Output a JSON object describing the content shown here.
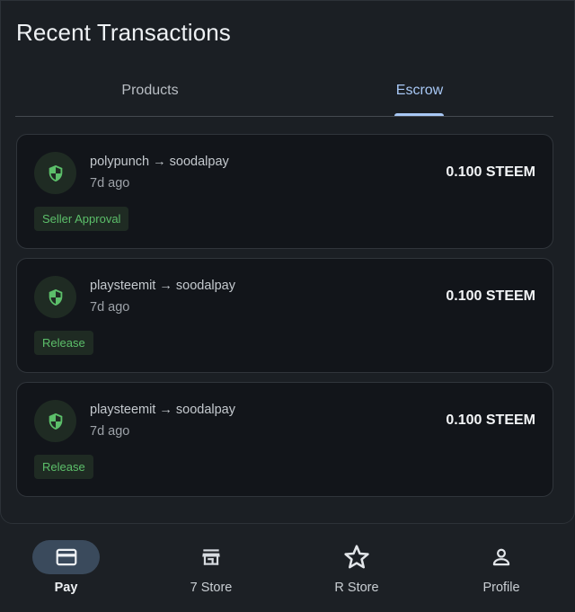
{
  "header": {
    "title": "Recent Transactions"
  },
  "tabs": [
    {
      "label": "Products",
      "active": false
    },
    {
      "label": "Escrow",
      "active": true
    }
  ],
  "transactions": [
    {
      "from": "polypunch",
      "to": "soodalpay",
      "parties": "polypunch → soodalpay",
      "time": "7d ago",
      "amount": "0.100 STEEM",
      "status": "Seller Approval"
    },
    {
      "from": "playsteemit",
      "to": "soodalpay",
      "parties": "playsteemit → soodalpay",
      "time": "7d ago",
      "amount": "0.100 STEEM",
      "status": "Release"
    },
    {
      "from": "playsteemit",
      "to": "soodalpay",
      "parties": "playsteemit → soodalpay",
      "time": "7d ago",
      "amount": "0.100 STEEM",
      "status": "Release"
    }
  ],
  "bottom_nav": [
    {
      "label": "Pay",
      "icon": "credit-card-icon",
      "active": true
    },
    {
      "label": "7 Store",
      "icon": "storefront-icon",
      "active": false
    },
    {
      "label": "R Store",
      "icon": "star-icon",
      "active": false
    },
    {
      "label": "Profile",
      "icon": "person-icon",
      "active": false
    }
  ],
  "colors": {
    "accent": "#a8c8f5",
    "status_green": "#5cbf6a",
    "card_bg": "#12151a",
    "active_pill": "#3a4a5c"
  }
}
